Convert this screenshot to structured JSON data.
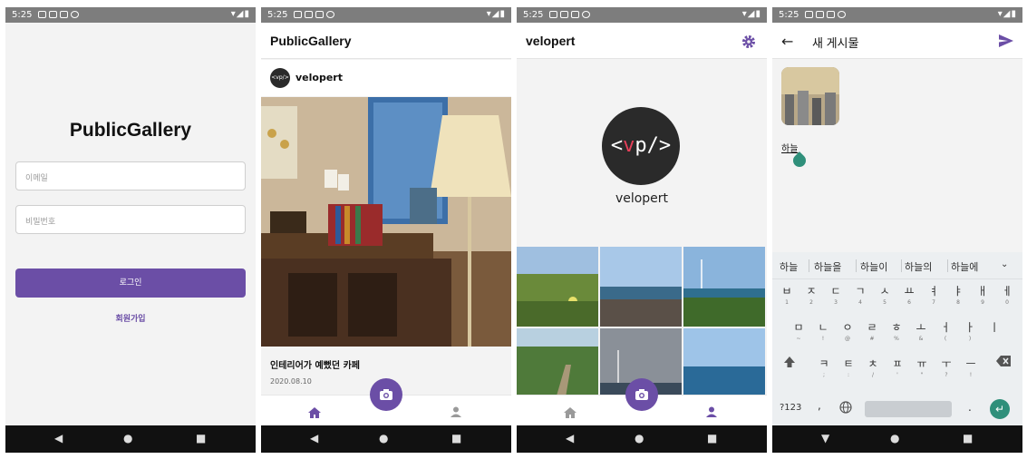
{
  "status": {
    "time": "5:25",
    "right_icons": "▾◢▮"
  },
  "login": {
    "title": "PublicGallery",
    "email_placeholder": "이메일",
    "password_placeholder": "비밀번호",
    "login_label": "로그인",
    "signup_label": "회원가입"
  },
  "feed": {
    "title": "PublicGallery",
    "post": {
      "avatar_text": "<vp/>",
      "username": "velopert",
      "description": "인테리어가 예뻤던 카페",
      "date": "2020.08.10"
    }
  },
  "profile": {
    "title": "velopert",
    "avatar_prefix": "<",
    "avatar_vp_v": "v",
    "avatar_vp_p": "p",
    "avatar_suffix": "/>",
    "name": "velopert"
  },
  "compose": {
    "title": "새 게시물",
    "draft_text": "하늘",
    "suggestions": [
      "하늘",
      "하늘을",
      "하늘이",
      "하늘의",
      "하늘에"
    ],
    "row1": [
      [
        "ㅂ",
        "1"
      ],
      [
        "ㅈ",
        "2"
      ],
      [
        "ㄷ",
        "3"
      ],
      [
        "ㄱ",
        "4"
      ],
      [
        "ㅅ",
        "5"
      ],
      [
        "ㅛ",
        "6"
      ],
      [
        "ㅕ",
        "7"
      ],
      [
        "ㅑ",
        "8"
      ],
      [
        "ㅐ",
        "9"
      ],
      [
        "ㅔ",
        "0"
      ]
    ],
    "row2": [
      [
        "ㅁ",
        "~"
      ],
      [
        "ㄴ",
        "!"
      ],
      [
        "ㅇ",
        "@"
      ],
      [
        "ㄹ",
        "#"
      ],
      [
        "ㅎ",
        "%"
      ],
      [
        "ㅗ",
        "&"
      ],
      [
        "ㅓ",
        "("
      ],
      [
        "ㅏ",
        ")"
      ],
      [
        "ㅣ",
        ""
      ]
    ],
    "row3": [
      [
        "ㅋ",
        ";"
      ],
      [
        "ㅌ",
        ":"
      ],
      [
        "ㅊ",
        "/"
      ],
      [
        "ㅍ",
        "'"
      ],
      [
        "ㅠ",
        "\""
      ],
      [
        "ㅜ",
        "?"
      ],
      [
        "ㅡ",
        "!"
      ]
    ],
    "symbols_key": "?123",
    "comma_key": ",",
    "period_key": "."
  },
  "colors": {
    "accent": "#6b4ea6",
    "teal": "#2f8f7a"
  }
}
